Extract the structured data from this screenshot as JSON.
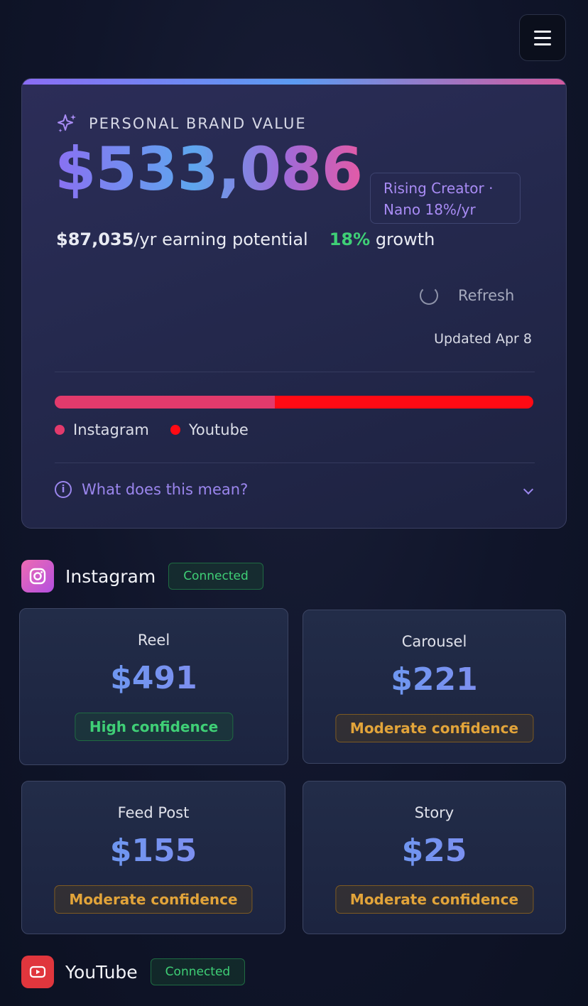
{
  "header": {
    "menu_icon": "hamburger-menu-icon"
  },
  "brand": {
    "label": "PERSONAL BRAND VALUE",
    "value": "$533,086",
    "tier_line1": "Rising Creator ·",
    "tier_line2": "Nano 18%/yr",
    "earning_amount": "$87,035",
    "earning_suffix": "/yr earning potential",
    "growth_pct": "18%",
    "growth_label": " growth",
    "refresh_label": "Refresh",
    "updated": "Updated Apr 8",
    "faq": "What does this mean?",
    "colors": {
      "instagram": "#e23a6c",
      "youtube": "#ff0a14",
      "growth": "#3fcf76"
    },
    "split": {
      "instagram_fraction": 0.46
    },
    "legend": [
      "Instagram",
      "Youtube"
    ]
  },
  "instagram": {
    "name": "Instagram",
    "status": "Connected",
    "cards": [
      {
        "title": "Reel",
        "value": "$491",
        "confidence": "High confidence"
      },
      {
        "title": "Carousel",
        "value": "$221",
        "confidence": "Moderate confidence"
      },
      {
        "title": "Feed Post",
        "value": "$155",
        "confidence": "Moderate confidence"
      },
      {
        "title": "Story",
        "value": "$25",
        "confidence": "Moderate confidence"
      }
    ]
  },
  "youtube": {
    "name": "YouTube",
    "status": "Connected"
  }
}
